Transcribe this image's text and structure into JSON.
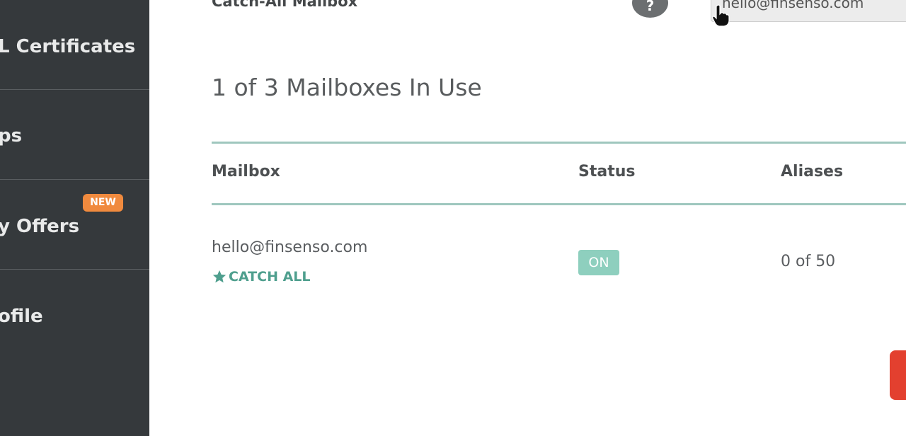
{
  "sidebar": {
    "items": [
      {
        "label": "L Certificates"
      },
      {
        "label": "ps"
      },
      {
        "label": "y Offers",
        "badge": "NEW"
      },
      {
        "label": "ofile"
      }
    ]
  },
  "settings": {
    "catch_all_label": "Catch-All Mailbox",
    "help_symbol": "?",
    "catch_all_value": "hello@finsenso.com"
  },
  "mailboxes": {
    "usage_title": "1 of 3 Mailboxes In Use",
    "columns": {
      "mailbox": "Mailbox",
      "status": "Status",
      "aliases": "Aliases"
    },
    "rows": [
      {
        "email": "hello@finsenso.com",
        "tag": "CATCH ALL",
        "status": "ON",
        "aliases": "0 of 50"
      }
    ]
  },
  "colors": {
    "sidebar_bg": "#35393c",
    "accent_teal": "#4f9f8e",
    "status_on": "#8ecfbe",
    "badge_new": "#f08a3e",
    "danger": "#e3402f"
  },
  "icons": {
    "help": "question-circle-icon",
    "catch_all": "star-icon",
    "cursor": "hand-pointer-icon"
  }
}
